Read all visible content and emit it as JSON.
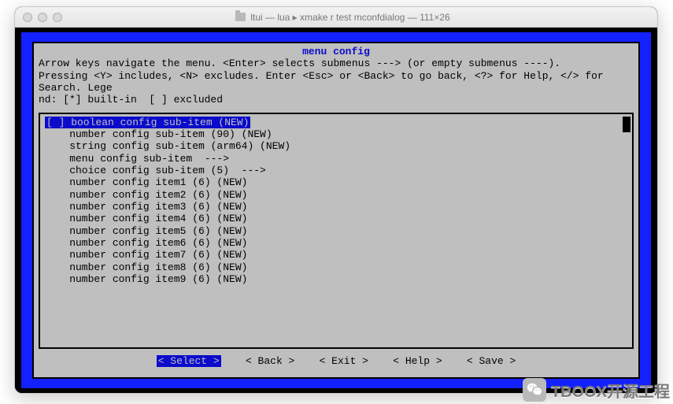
{
  "window": {
    "title": "ltui — lua ▸ xmake r test mconfdialog — 111×26"
  },
  "dialog": {
    "title": "menu config",
    "help_line1": "Arrow keys navigate the menu. <Enter> selects submenus ---> (or empty submenus ----).",
    "help_line2": "Pressing <Y> includes, <N> excludes. Enter <Esc> or <Back> to go back, <?> for Help, </> for Search. Lege",
    "help_line3": "nd: [*] built-in  [ ] excluded"
  },
  "menu": {
    "items": [
      "[ ] boolean config sub-item (NEW)",
      "    number config sub-item (90) (NEW)",
      "    string config sub-item (arm64) (NEW)",
      "    menu config sub-item  --->",
      "    choice config sub-item (5)  --->",
      "    number config item1 (6) (NEW)",
      "    number config item2 (6) (NEW)",
      "    number config item3 (6) (NEW)",
      "    number config item4 (6) (NEW)",
      "    number config item5 (6) (NEW)",
      "    number config item6 (6) (NEW)",
      "    number config item7 (6) (NEW)",
      "    number config item8 (6) (NEW)",
      "    number config item9 (6) (NEW)"
    ],
    "selected_index": 0
  },
  "buttons": {
    "select": "< Select >",
    "back": "< Back >",
    "exit": "< Exit >",
    "help": "< Help >",
    "save": "< Save >"
  },
  "watermark": "TBOOX开源工程"
}
